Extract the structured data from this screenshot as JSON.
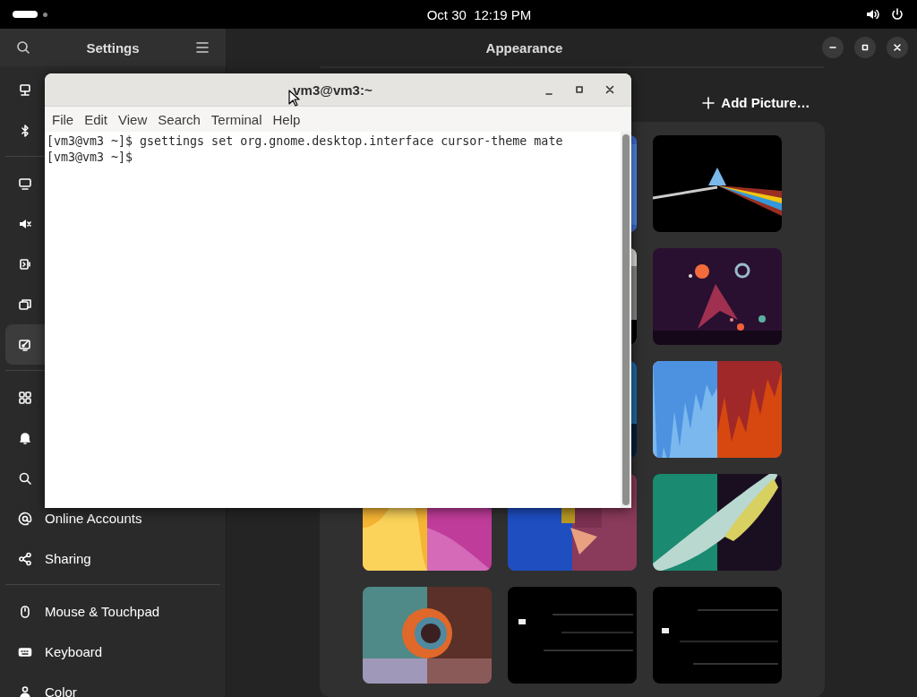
{
  "top_bar": {
    "clock": "Oct 30  12:19 PM"
  },
  "settings": {
    "title": "Settings",
    "page_title": "Appearance",
    "add_button": "Add Picture…",
    "sidebar_groups": [
      {
        "items": [
          {
            "selected": false
          },
          {
            "selected": false
          }
        ]
      },
      {
        "items": [
          {
            "selected": false
          },
          {
            "selected": false
          },
          {
            "selected": false
          },
          {
            "selected": false
          },
          {
            "selected": true
          }
        ]
      },
      {
        "items": [
          {
            "selected": false
          },
          {
            "selected": false
          },
          {
            "selected": false
          },
          {
            "label": "Online Accounts",
            "selected": false
          },
          {
            "label": "Sharing",
            "selected": false
          }
        ]
      },
      {
        "items": [
          {
            "label": "Mouse & Touchpad",
            "selected": false
          },
          {
            "label": "Keyboard",
            "selected": false
          },
          {
            "label": "Color",
            "selected": false
          }
        ]
      }
    ]
  },
  "terminal": {
    "title": "vm3@vm3:~",
    "menu": [
      "File",
      "Edit",
      "View",
      "Search",
      "Terminal",
      "Help"
    ],
    "lines": [
      "[vm3@vm3 ~]$ gsettings set org.gnome.desktop.interface cursor-theme mate",
      "[vm3@vm3 ~]$"
    ]
  }
}
